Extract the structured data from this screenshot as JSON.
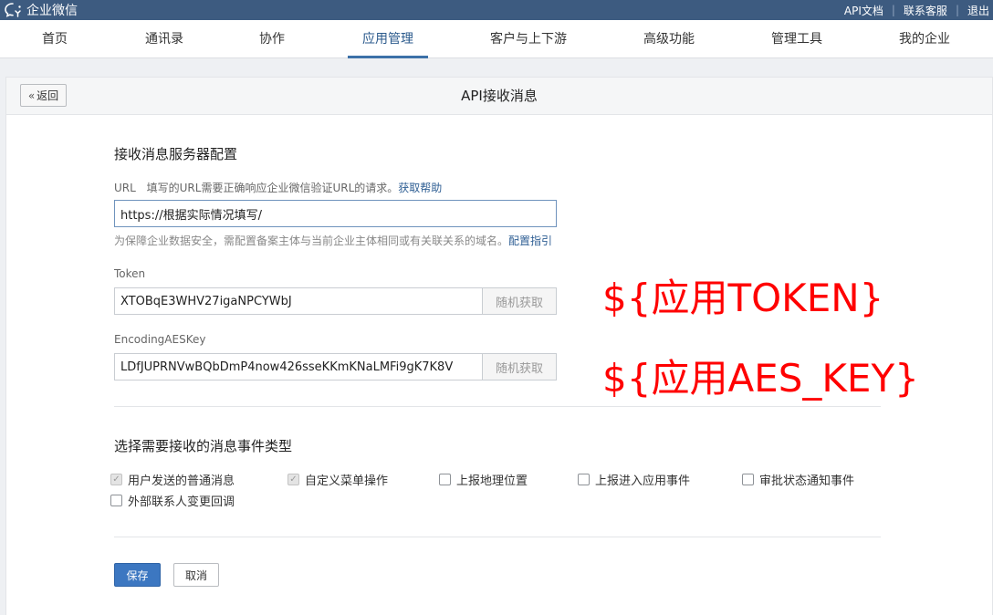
{
  "topbar": {
    "brand": "企业微信",
    "links": [
      "API文档",
      "联系客服",
      "退出"
    ]
  },
  "nav": {
    "items": [
      "首页",
      "通讯录",
      "协作",
      "应用管理",
      "客户与上下游",
      "高级功能",
      "管理工具",
      "我的企业"
    ],
    "active": "应用管理"
  },
  "page": {
    "back_label": "返回",
    "title": "API接收消息"
  },
  "server_config": {
    "title": "接收消息服务器配置",
    "url_label": "URL",
    "url_desc": "填写的URL需要正确响应企业微信验证URL的请求。",
    "url_help_link": "获取帮助",
    "url_value": "https://根据实际情况填写/",
    "url_hint": "为保障企业数据安全，需配置备案主体与当前企业主体相同或有关联关系的域名。",
    "url_hint_link": "配置指引",
    "token_label": "Token",
    "token_value": "XTOBqE3WHV27igaNPCYWbJ",
    "token_random": "随机获取",
    "aes_label": "EncodingAESKey",
    "aes_value": "LDfJUPRNVwBQbDmP4now426sseKKmKNaLMFi9gK7K8V",
    "aes_random": "随机获取"
  },
  "annotations": {
    "token": "${应用TOKEN}",
    "aes": "${应用AES_KEY}",
    "color": "#ff0000"
  },
  "events": {
    "title": "选择需要接收的消息事件类型",
    "options": [
      {
        "label": "用户发送的普通消息",
        "checked": true,
        "disabled": true
      },
      {
        "label": "自定义菜单操作",
        "checked": true,
        "disabled": true
      },
      {
        "label": "上报地理位置",
        "checked": false
      },
      {
        "label": "上报进入应用事件",
        "checked": false
      },
      {
        "label": "审批状态通知事件",
        "checked": false
      },
      {
        "label": "外部联系人变更回调",
        "checked": false
      }
    ]
  },
  "actions": {
    "save": "保存",
    "cancel": "取消"
  },
  "colors": {
    "topbar": "#3d5b80",
    "accent": "#3c77c1",
    "link": "#2f5f94"
  }
}
